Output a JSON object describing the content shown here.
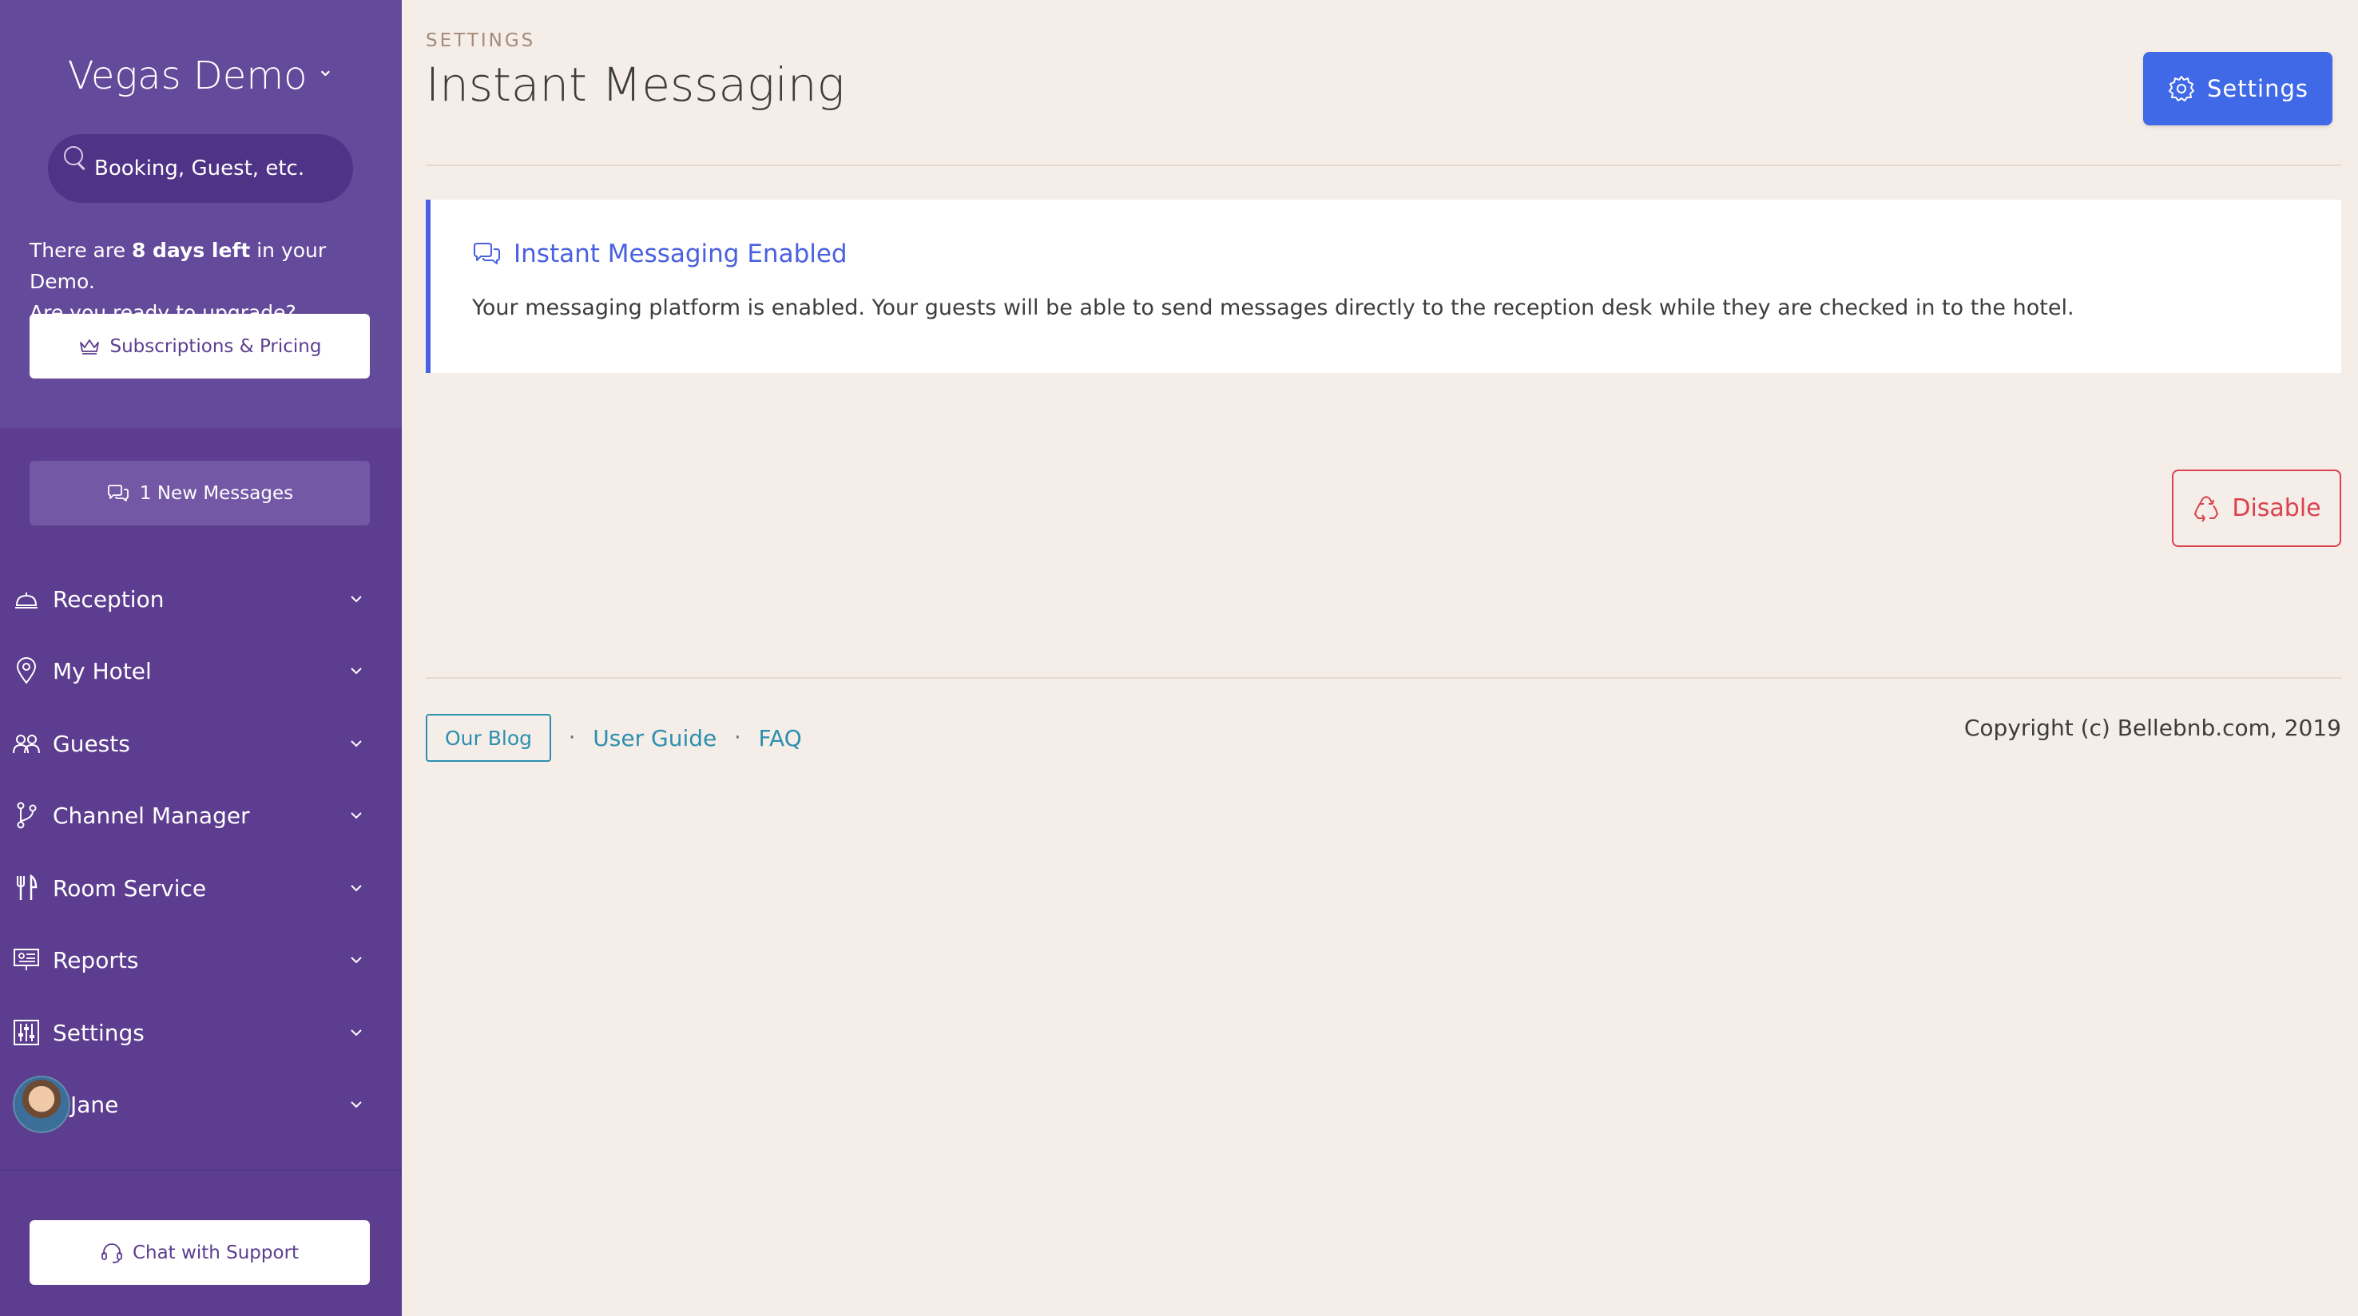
{
  "sidebar": {
    "org_name": "Vegas Demo",
    "search": {
      "placeholder": "Booking, Guest, etc."
    },
    "demo_notice": {
      "prefix": "There are ",
      "days": "8 days left",
      "suffix": " in your Demo.",
      "line2": "Are you ready to upgrade?"
    },
    "subscriptions_label": "Subscriptions & Pricing",
    "new_messages_label": "1 New Messages",
    "nav_items": [
      {
        "label": "Reception",
        "icon": "service-bell-icon"
      },
      {
        "label": "My Hotel",
        "icon": "map-pin-icon"
      },
      {
        "label": "Guests",
        "icon": "guests-icon"
      },
      {
        "label": "Channel Manager",
        "icon": "git-branch-icon"
      },
      {
        "label": "Room Service",
        "icon": "fork-knife-icon"
      },
      {
        "label": "Reports",
        "icon": "presentation-icon"
      },
      {
        "label": "Settings",
        "icon": "sliders-icon"
      }
    ],
    "user": {
      "name": "Jane"
    },
    "chat_support_label": "Chat with Support"
  },
  "header": {
    "breadcrumb": "SETTINGS",
    "title": "Instant Messaging",
    "settings_button_label": "Settings"
  },
  "status_card": {
    "title": "Instant Messaging Enabled",
    "text": "Your messaging platform is enabled. Your guests will be able to send messages directly to the reception desk while they are checked in to the hotel."
  },
  "disable_button_label": "Disable",
  "footer": {
    "blog_label": "Our Blog",
    "user_guide_label": "User Guide",
    "faq_label": "FAQ",
    "separator": "·",
    "copyright": "Copyright (c) Bellebnb.com, 2019"
  },
  "colors": {
    "sidebar": "#5c3d8f",
    "accent_blue": "#3f69e6",
    "danger": "#d9424f",
    "link": "#2d8fb0",
    "background": "#f5ede7"
  }
}
